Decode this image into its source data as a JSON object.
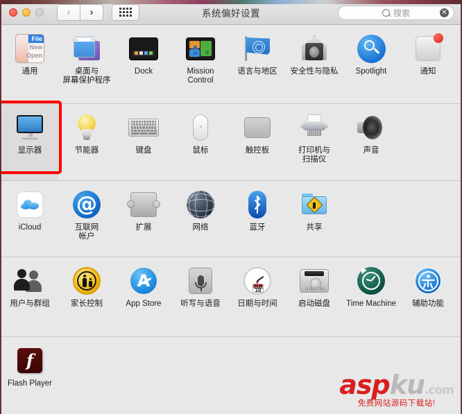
{
  "window": {
    "title": "系统偏好设置",
    "traffic_lights": [
      "close",
      "minimize",
      "zoom"
    ],
    "nav": {
      "back": "‹",
      "forward": "›",
      "grid": "grid-view"
    },
    "search": {
      "placeholder": "搜索",
      "value": "",
      "clear": "✕"
    }
  },
  "rows": [
    {
      "id": "row-personal",
      "items": [
        {
          "name": "general",
          "label": "通用",
          "icon": "general-icon"
        },
        {
          "name": "desktop-saver",
          "label": "桌面与\n屏幕保护程序",
          "icon": "desktop-screensaver-icon"
        },
        {
          "name": "dock",
          "label": "Dock",
          "icon": "dock-icon"
        },
        {
          "name": "mission-control",
          "label": "Mission\nControl",
          "icon": "mission-control-icon"
        },
        {
          "name": "language-region",
          "label": "语言与地区",
          "icon": "language-region-icon"
        },
        {
          "name": "security",
          "label": "安全性与隐私",
          "icon": "security-privacy-icon"
        },
        {
          "name": "spotlight",
          "label": "Spotlight",
          "icon": "spotlight-icon"
        },
        {
          "name": "notifications",
          "label": "通知",
          "icon": "notifications-icon"
        }
      ]
    },
    {
      "id": "row-hardware",
      "items": [
        {
          "name": "displays",
          "label": "显示器",
          "icon": "displays-icon",
          "selected": true
        },
        {
          "name": "energy-saver",
          "label": "节能器",
          "icon": "energy-saver-icon"
        },
        {
          "name": "keyboard",
          "label": "键盘",
          "icon": "keyboard-icon"
        },
        {
          "name": "mouse",
          "label": "鼠标",
          "icon": "mouse-icon"
        },
        {
          "name": "trackpad",
          "label": "触控板",
          "icon": "trackpad-icon"
        },
        {
          "name": "printers",
          "label": "打印机与\n扫描仪",
          "icon": "printer-scanner-icon"
        },
        {
          "name": "sound",
          "label": "声音",
          "icon": "sound-icon"
        }
      ]
    },
    {
      "id": "row-internet",
      "items": [
        {
          "name": "icloud",
          "label": "iCloud",
          "icon": "icloud-icon"
        },
        {
          "name": "internet-accounts",
          "label": "互联网\n帐户",
          "icon": "internet-accounts-icon"
        },
        {
          "name": "extensions",
          "label": "扩展",
          "icon": "extensions-icon"
        },
        {
          "name": "network",
          "label": "网络",
          "icon": "network-icon"
        },
        {
          "name": "bluetooth",
          "label": "蓝牙",
          "icon": "bluetooth-icon"
        },
        {
          "name": "sharing",
          "label": "共享",
          "icon": "sharing-icon"
        }
      ]
    },
    {
      "id": "row-system",
      "items": [
        {
          "name": "users-groups",
          "label": "用户与群组",
          "icon": "users-groups-icon"
        },
        {
          "name": "parental-controls",
          "label": "家长控制",
          "icon": "parental-controls-icon"
        },
        {
          "name": "app-store",
          "label": "App Store",
          "icon": "app-store-icon"
        },
        {
          "name": "dictation-speech",
          "label": "听写与语音",
          "icon": "dictation-speech-icon"
        },
        {
          "name": "date-time",
          "label": "日期与时间",
          "icon": "date-time-icon"
        },
        {
          "name": "startup-disk",
          "label": "启动磁盘",
          "icon": "startup-disk-icon"
        },
        {
          "name": "time-machine",
          "label": "Time Machine",
          "icon": "time-machine-icon"
        },
        {
          "name": "accessibility",
          "label": "辅助功能",
          "icon": "accessibility-icon"
        }
      ]
    },
    {
      "id": "row-other",
      "items": [
        {
          "name": "flash-player",
          "label": "Flash Player",
          "icon": "flash-player-icon"
        }
      ]
    }
  ],
  "selection_highlight": {
    "color": "#ff0000",
    "target": "显示器"
  },
  "calendar_badge": {
    "month": "JUL",
    "day": "18"
  },
  "watermark": {
    "part1": "asp",
    "part2": "ku",
    "part3": ".com",
    "subtitle": "免费网站源码下载站!"
  }
}
